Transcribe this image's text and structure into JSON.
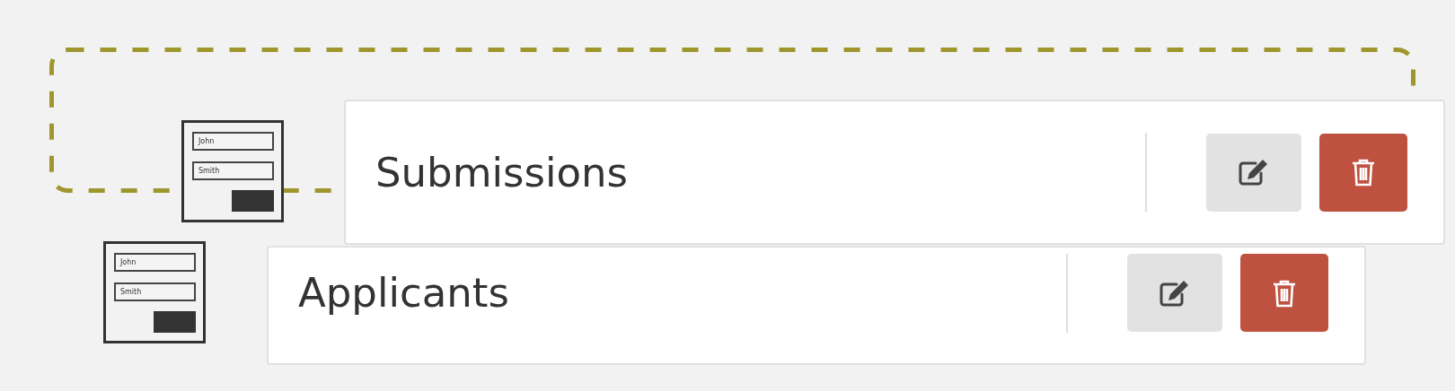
{
  "drop_zone": {
    "kind": "dashed"
  },
  "forms": [
    {
      "fields": [
        "John",
        "Smith"
      ]
    },
    {
      "fields": [
        "John",
        "Smith"
      ]
    }
  ],
  "cards": [
    {
      "title": "Submissions"
    },
    {
      "title": "Applicants"
    }
  ]
}
